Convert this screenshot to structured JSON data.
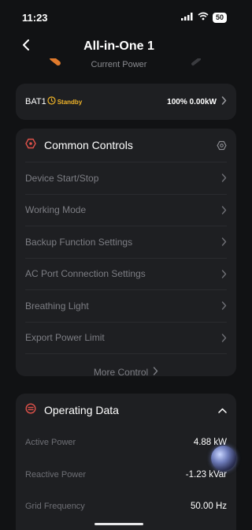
{
  "status_bar": {
    "time": "11:23",
    "battery": "50"
  },
  "nav": {
    "title": "All-in-One 1"
  },
  "hero": {
    "label": "Current Power"
  },
  "battery_card": {
    "name": "BAT1",
    "status": "Standby",
    "value": "100% 0.00kW"
  },
  "common_controls": {
    "title": "Common Controls",
    "items": [
      {
        "label": "Device Start/Stop"
      },
      {
        "label": "Working Mode"
      },
      {
        "label": "Backup Function Settings"
      },
      {
        "label": "AC Port Connection Settings"
      },
      {
        "label": "Breathing Light"
      },
      {
        "label": "Export Power Limit"
      }
    ],
    "more_label": "More Control"
  },
  "operating_data": {
    "title": "Operating Data",
    "rows": [
      {
        "label": "Active Power",
        "value": "4.88 kW"
      },
      {
        "label": "Reactive Power",
        "value": "-1.23 kVar"
      },
      {
        "label": "Grid Frequency",
        "value": "50.00 Hz"
      }
    ]
  },
  "colors": {
    "background": "#111214",
    "card": "#1e1f22",
    "accent_orange": "#e07a2c",
    "standby_yellow": "#f0b429",
    "icon_red": "#e0524a"
  },
  "icons": {
    "back": "chevron-left-icon",
    "signal": "signal-icon",
    "wifi": "wifi-icon",
    "battery": "battery-icon",
    "standby": "clock-icon",
    "chevron": "chevron-right-icon",
    "controls": "hexagon-icon",
    "settings": "settings-icon",
    "operating": "operating-data-icon",
    "collapse": "chevron-up-icon"
  }
}
